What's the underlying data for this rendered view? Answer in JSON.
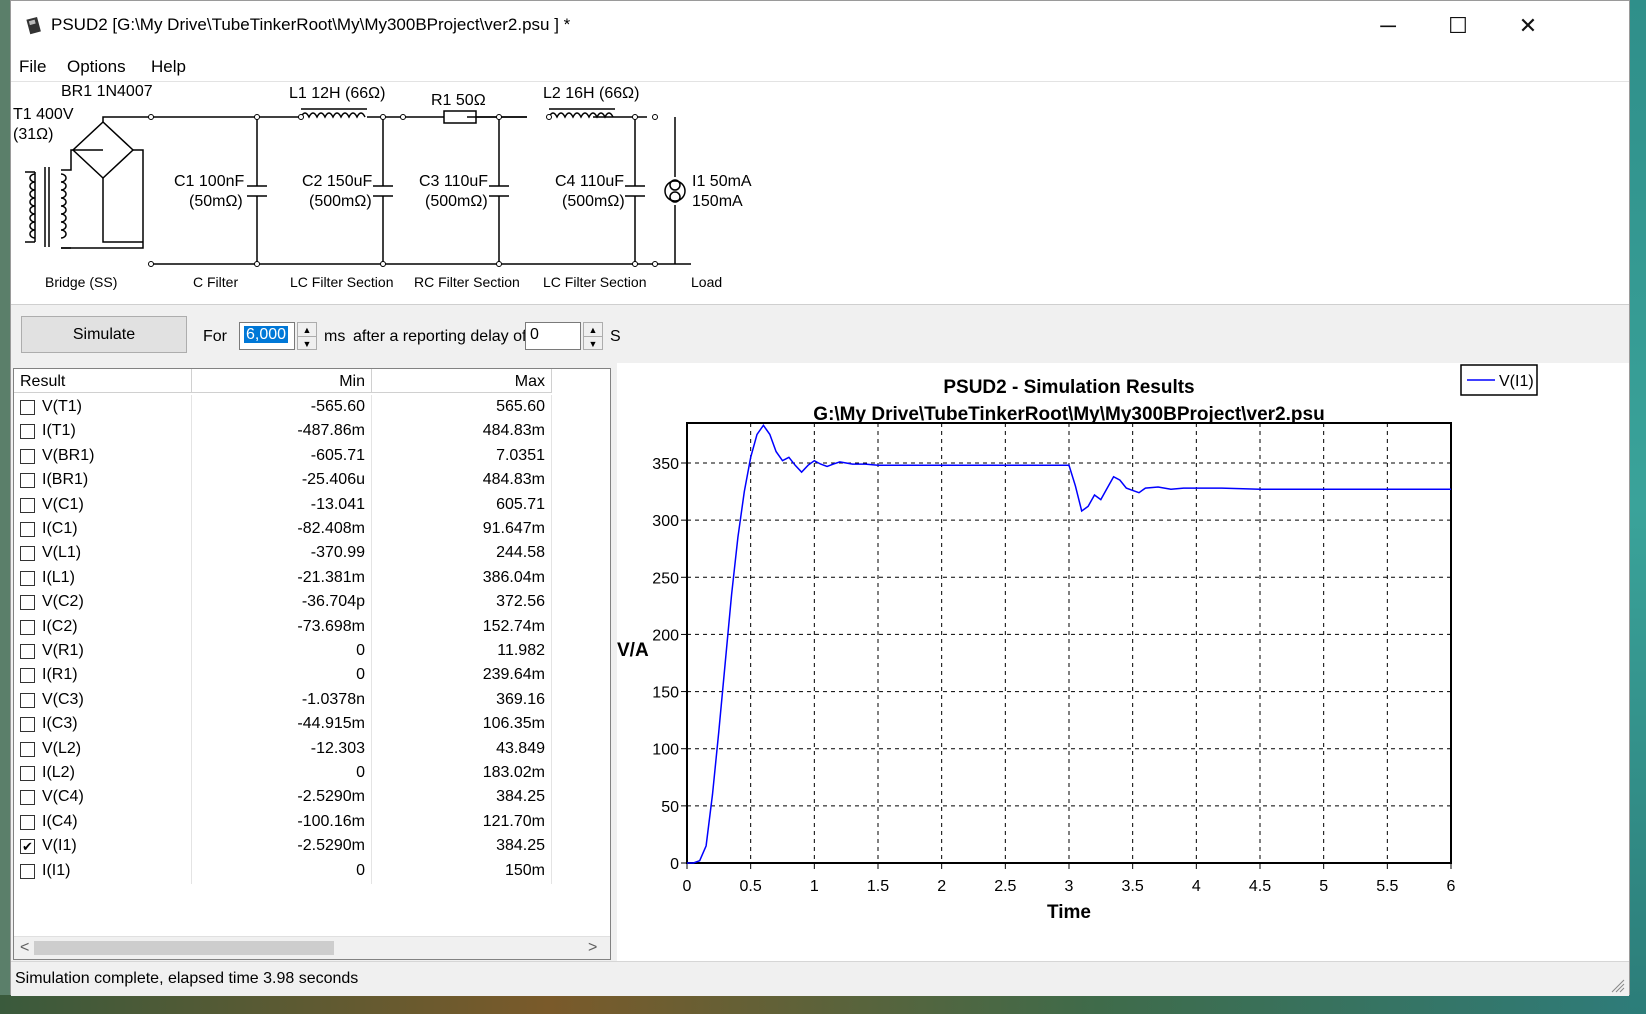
{
  "window": {
    "title": "PSUD2  [G:\\My Drive\\TubeTinkerRoot\\My\\My300BProject\\ver2.psu ] *",
    "minimize_glyph": "─",
    "maximize_glyph": "☐",
    "close_glyph": "✕"
  },
  "menu": [
    "File",
    "Options",
    "Help"
  ],
  "schematic": {
    "components": {
      "br1": "BR1 1N4007",
      "t1_line1": "T1 400V",
      "t1_line2": "(31Ω)",
      "l1": "L1 12H (66Ω)",
      "r1": "R1 50Ω",
      "l2": "L2 16H (66Ω)",
      "c1_line1": "C1 100nF",
      "c1_line2": "(50mΩ)",
      "c2_line1": "C2 150uF",
      "c2_line2": "(500mΩ)",
      "c3_line1": "C3 110uF",
      "c3_line2": "(500mΩ)",
      "c4_line1": "C4 110uF",
      "c4_line2": "(500mΩ)",
      "i1_line1": "I1 50mA",
      "i1_line2": "150mA"
    },
    "sections": [
      "Bridge (SS)",
      "C Filter",
      "LC Filter Section",
      "RC Filter Section",
      "LC Filter Section",
      "Load"
    ]
  },
  "toolbar": {
    "simulate_label": "Simulate",
    "for_label": "For",
    "duration_value": "6,000",
    "ms_label": "ms",
    "delay_label": "after a reporting delay of",
    "delay_value": "0",
    "s_label": "S"
  },
  "results": {
    "columns": [
      "Result",
      "Min",
      "Max"
    ],
    "rows": [
      {
        "name": "V(T1)",
        "min": "-565.60",
        "max": "565.60",
        "checked": false
      },
      {
        "name": "I(T1)",
        "min": "-487.86m",
        "max": "484.83m",
        "checked": false
      },
      {
        "name": "V(BR1)",
        "min": "-605.71",
        "max": "7.0351",
        "checked": false
      },
      {
        "name": "I(BR1)",
        "min": "-25.406u",
        "max": "484.83m",
        "checked": false
      },
      {
        "name": "V(C1)",
        "min": "-13.041",
        "max": "605.71",
        "checked": false
      },
      {
        "name": "I(C1)",
        "min": "-82.408m",
        "max": "91.647m",
        "checked": false
      },
      {
        "name": "V(L1)",
        "min": "-370.99",
        "max": "244.58",
        "checked": false
      },
      {
        "name": "I(L1)",
        "min": "-21.381m",
        "max": "386.04m",
        "checked": false
      },
      {
        "name": "V(C2)",
        "min": "-36.704p",
        "max": "372.56",
        "checked": false
      },
      {
        "name": "I(C2)",
        "min": "-73.698m",
        "max": "152.74m",
        "checked": false
      },
      {
        "name": "V(R1)",
        "min": "0",
        "max": "11.982",
        "checked": false
      },
      {
        "name": "I(R1)",
        "min": "0",
        "max": "239.64m",
        "checked": false
      },
      {
        "name": "V(C3)",
        "min": "-1.0378n",
        "max": "369.16",
        "checked": false
      },
      {
        "name": "I(C3)",
        "min": "-44.915m",
        "max": "106.35m",
        "checked": false
      },
      {
        "name": "V(L2)",
        "min": "-12.303",
        "max": "43.849",
        "checked": false
      },
      {
        "name": "I(L2)",
        "min": "0",
        "max": "183.02m",
        "checked": false
      },
      {
        "name": "V(C4)",
        "min": "-2.5290m",
        "max": "384.25",
        "checked": false
      },
      {
        "name": "I(C4)",
        "min": "-100.16m",
        "max": "121.70m",
        "checked": false
      },
      {
        "name": "V(I1)",
        "min": "-2.5290m",
        "max": "384.25",
        "checked": true
      },
      {
        "name": "I(I1)",
        "min": "0",
        "max": "150m",
        "checked": false
      }
    ],
    "scroll_left": "<",
    "scroll_right": ">"
  },
  "status": {
    "text": "Simulation complete, elapsed time 3.98 seconds"
  },
  "chart_data": {
    "type": "line",
    "title": "PSUD2 - Simulation Results",
    "subtitle": "G:\\My Drive\\TubeTinkerRoot\\My\\My300BProject\\ver2.psu",
    "xlabel": "Time",
    "ylabel": "V/A",
    "xlim": [
      0,
      6
    ],
    "ylim": [
      0,
      385
    ],
    "xticks": [
      "0",
      "0.5",
      "1",
      "1.5",
      "2",
      "2.5",
      "3",
      "3.5",
      "4",
      "4.5",
      "5",
      "5.5",
      "6"
    ],
    "yticks": [
      "0",
      "50",
      "100",
      "150",
      "200",
      "250",
      "300",
      "350"
    ],
    "grid": true,
    "legend_position": "top-right",
    "series_color": "#0000ff",
    "series": [
      {
        "name": "V(I1)",
        "x": [
          0,
          0.05,
          0.1,
          0.15,
          0.2,
          0.25,
          0.3,
          0.35,
          0.4,
          0.45,
          0.5,
          0.55,
          0.6,
          0.65,
          0.7,
          0.75,
          0.8,
          0.85,
          0.9,
          0.95,
          1.0,
          1.05,
          1.1,
          1.15,
          1.2,
          1.25,
          1.3,
          1.4,
          1.5,
          1.7,
          2.0,
          2.5,
          2.99,
          3.0,
          3.05,
          3.1,
          3.15,
          3.2,
          3.25,
          3.3,
          3.35,
          3.4,
          3.45,
          3.5,
          3.55,
          3.6,
          3.7,
          3.8,
          3.9,
          4.0,
          4.2,
          4.5,
          5.0,
          5.5,
          6.0
        ],
        "values": [
          0,
          0,
          2,
          15,
          60,
          115,
          175,
          235,
          285,
          325,
          355,
          375,
          383,
          375,
          360,
          352,
          355,
          348,
          342,
          348,
          352,
          349,
          347,
          349,
          351,
          350,
          349,
          349,
          348,
          348,
          348,
          348,
          348,
          348,
          330,
          308,
          312,
          322,
          318,
          328,
          338,
          335,
          328,
          326,
          324,
          328,
          329,
          327,
          328,
          328,
          328,
          327,
          327,
          327,
          327
        ]
      }
    ]
  }
}
